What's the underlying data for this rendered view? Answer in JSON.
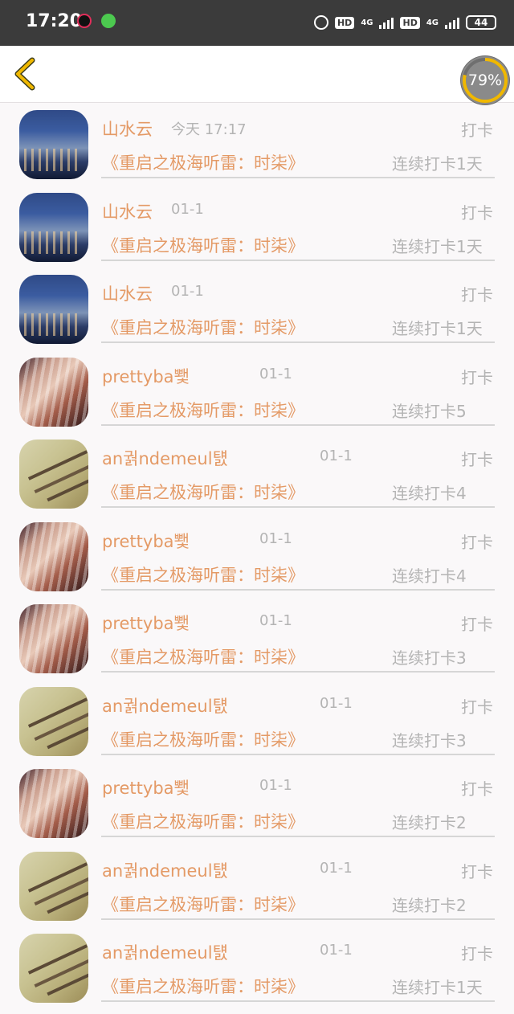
{
  "status_bar": {
    "time": "17:20",
    "hd1": "HD",
    "net1": "4G",
    "hd2": "HD",
    "net2": "4G",
    "battery": "44"
  },
  "header": {
    "back_icon": "chevron-left-icon",
    "progress_label": "79%",
    "progress_value": 0.79,
    "accent_color": "#f0b800"
  },
  "colors": {
    "accent_text": "#e49a66",
    "muted_text": "#b4b4b4"
  },
  "rows": [
    {
      "name": "山水云",
      "date": "今天 17:17",
      "action": "打卡",
      "book": "《重启之极海听雷：时柒》",
      "streak": "连续打卡1天",
      "avatar": "city-night-girl"
    },
    {
      "name": "山水云",
      "date": "01-1",
      "action": "打卡",
      "book": "《重启之极海听雷：时柒》",
      "streak": "连续打卡1天",
      "avatar": "city-night-girl"
    },
    {
      "name": "山水云",
      "date": "01-1",
      "action": "打卡",
      "book": "《重启之极海听雷：时柒》",
      "streak": "连续打卡1天",
      "avatar": "city-night-girl"
    },
    {
      "name": "prettyba뾏",
      "date": "01-1",
      "action": "打卡",
      "book": "《重启之极海听雷：时柒》",
      "streak": "连续打卡5",
      "avatar": "piano-keys"
    },
    {
      "name": "an궑ndemeul턠",
      "date": "01-1",
      "action": "打卡",
      "book": "《重启之极海听雷：时柒》",
      "streak": "连续打卡4",
      "avatar": "blossom-branch"
    },
    {
      "name": "prettyba뾏",
      "date": "01-1",
      "action": "打卡",
      "book": "《重启之极海听雷：时柒》",
      "streak": "连续打卡4",
      "avatar": "piano-keys"
    },
    {
      "name": "prettyba뾏",
      "date": "01-1",
      "action": "打卡",
      "book": "《重启之极海听雷：时柒》",
      "streak": "连续打卡3",
      "avatar": "piano-keys"
    },
    {
      "name": "an궑ndemeul턠",
      "date": "01-1",
      "action": "打卡",
      "book": "《重启之极海听雷：时柒》",
      "streak": "连续打卡3",
      "avatar": "blossom-branch"
    },
    {
      "name": "prettyba뾏",
      "date": "01-1",
      "action": "打卡",
      "book": "《重启之极海听雷：时柒》",
      "streak": "连续打卡2",
      "avatar": "piano-keys"
    },
    {
      "name": "an궑ndemeul턠",
      "date": "01-1",
      "action": "打卡",
      "book": "《重启之极海听雷：时柒》",
      "streak": "连续打卡2",
      "avatar": "blossom-branch"
    },
    {
      "name": "an궑ndemeul턠",
      "date": "01-1",
      "action": "打卡",
      "book": "《重启之极海听雷：时柒》",
      "streak": "连续打卡1天",
      "avatar": "blossom-branch"
    }
  ]
}
